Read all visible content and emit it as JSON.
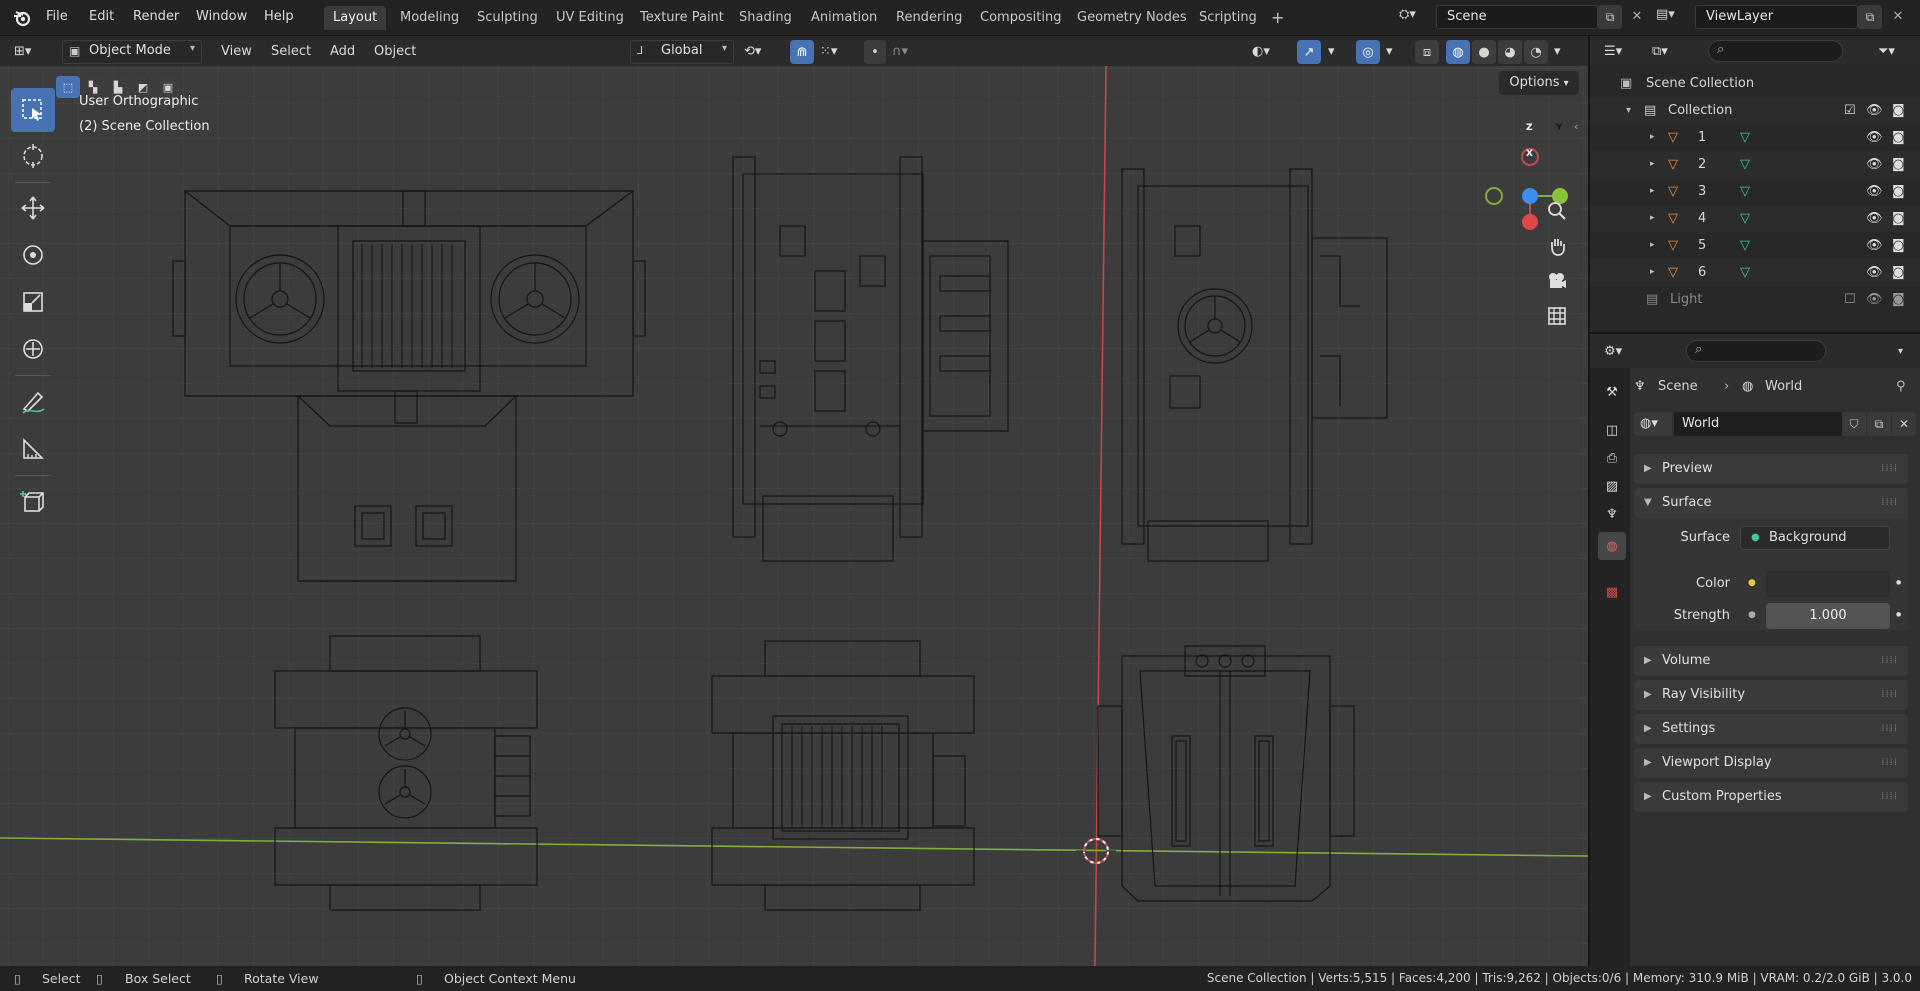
{
  "menu": {
    "file": "File",
    "edit": "Edit",
    "render": "Render",
    "window": "Window",
    "help": "Help"
  },
  "workspaces": [
    "Layout",
    "Modeling",
    "Sculpting",
    "UV Editing",
    "Texture Paint",
    "Shading",
    "Animation",
    "Rendering",
    "Compositing",
    "Geometry Nodes",
    "Scripting"
  ],
  "workspace_add": "+",
  "scene": {
    "name": "Scene"
  },
  "view_layer": {
    "name": "ViewLayer"
  },
  "viewport_header": {
    "mode": "Object Mode",
    "view": "View",
    "select": "Select",
    "add": "Add",
    "object": "Object",
    "orientation": "Global",
    "options": "Options"
  },
  "overlay_text": {
    "view_name": "User Orthographic",
    "collection": "(2) Scene Collection"
  },
  "gizmo": {
    "x": "X",
    "y": "Y",
    "z": "Z"
  },
  "outliner": {
    "root": "Scene Collection",
    "collection": "Collection",
    "objects": [
      "1",
      "2",
      "3",
      "4",
      "5",
      "6"
    ],
    "light": "Light"
  },
  "properties": {
    "breadcrumb_scene": "Scene",
    "breadcrumb_world": "World",
    "datablock": "World",
    "panels": {
      "preview": "Preview",
      "surface": "Surface",
      "volume": "Volume",
      "ray_visibility": "Ray Visibility",
      "settings": "Settings",
      "viewport_display": "Viewport Display",
      "custom_properties": "Custom Properties"
    },
    "surface_label": "Surface",
    "surface_value": "Background",
    "color_label": "Color",
    "strength_label": "Strength",
    "strength_value": "1.000"
  },
  "statusbar": {
    "select": "Select",
    "box_select": "Box Select",
    "rotate_view": "Rotate View",
    "context_menu": "Object Context Menu",
    "stats": "Scene Collection | Verts:5,515 | Faces:4,200 | Tris:9,262 | Objects:0/6 | Memory: 310.9 MiB | VRAM: 0.2/2.0 GiB | 3.0.0"
  },
  "colors": {
    "accent": "#4772b3",
    "viewport_bg": "#3c3c3c",
    "x_axis": "#e04848",
    "y_axis": "#8bc43a",
    "z_axis": "#3d8ef0",
    "mesh_icon": "#e8903e",
    "data_icon": "#3cc89c"
  }
}
